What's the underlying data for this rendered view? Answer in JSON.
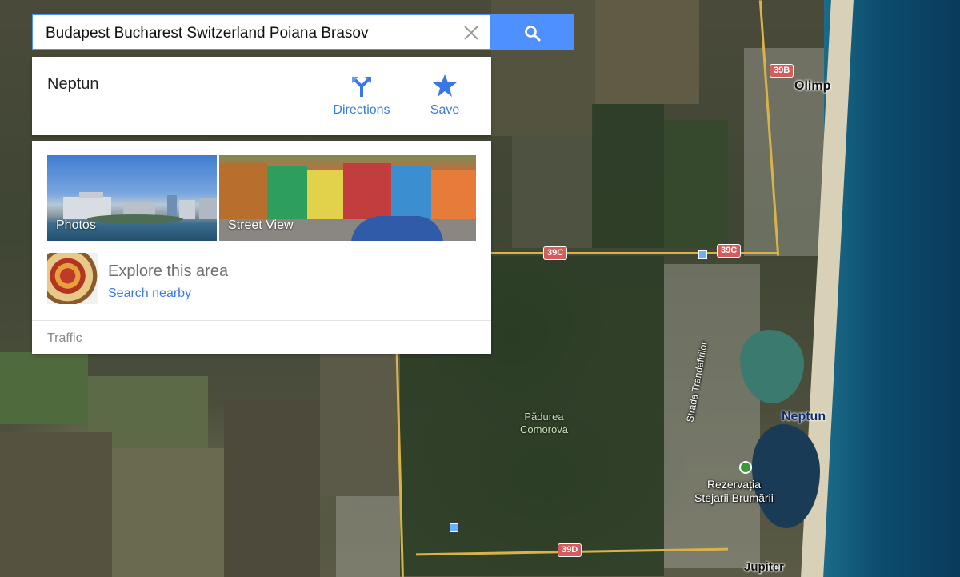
{
  "search": {
    "query": "Budapest Bucharest Switzerland Poiana Brasov",
    "clear_icon": "close-icon",
    "search_icon": "search-icon"
  },
  "place": {
    "name": "Neptun",
    "actions": [
      {
        "label": "Directions",
        "icon": "directions-icon"
      },
      {
        "label": "Save",
        "icon": "star-icon"
      }
    ]
  },
  "explore": {
    "photos_label": "Photos",
    "streetview_label": "Street View",
    "title": "Explore this area",
    "link": "Search nearby",
    "traffic_label": "Traffic"
  },
  "map": {
    "road_shields": [
      "39B",
      "39C",
      "39C",
      "39D"
    ],
    "labels": {
      "olimp": "Olimp",
      "neptun": "Neptun",
      "padurea_1": "Pădurea",
      "padurea_2": "Comorova",
      "strada": "Strada Trandafirilor",
      "rezervatia_1": "Rezervația",
      "rezervatia_2": "Stejarii Brumării",
      "jupiter": "Jupiter"
    },
    "colors": {
      "accent": "#4d90fe",
      "link": "#3b78e7",
      "shield": "#d35c5c"
    }
  }
}
